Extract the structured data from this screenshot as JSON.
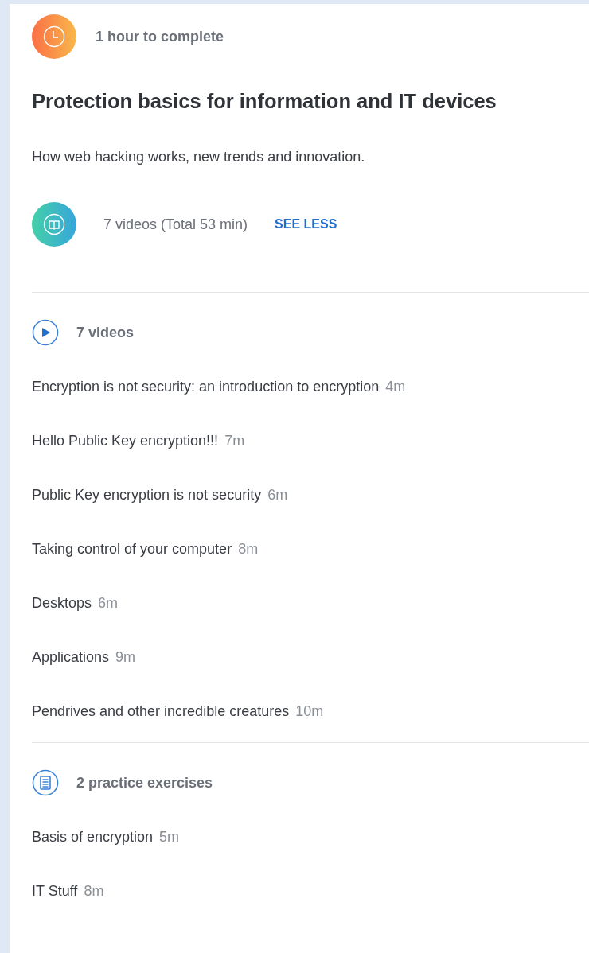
{
  "duration": {
    "label": "1 hour to complete"
  },
  "title": "Protection basics for information and IT devices",
  "description": "How web hacking works, new trends and innovation.",
  "summary": {
    "text": "7 videos (Total 53 min)",
    "toggle": "SEE LESS"
  },
  "sections": [
    {
      "kind": "videos",
      "heading": "7 videos",
      "items": [
        {
          "title": "Encryption is not security: an introduction to encryption",
          "duration": "4m"
        },
        {
          "title": "Hello Public Key encryption!!!",
          "duration": "7m"
        },
        {
          "title": "Public Key encryption is not security",
          "duration": "6m"
        },
        {
          "title": "Taking control of your computer",
          "duration": "8m"
        },
        {
          "title": "Desktops",
          "duration": "6m"
        },
        {
          "title": "Applications",
          "duration": "9m"
        },
        {
          "title": "Pendrives and other incredible creatures",
          "duration": "10m"
        }
      ]
    },
    {
      "kind": "exercises",
      "heading": "2 practice exercises",
      "items": [
        {
          "title": "Basis of encryption",
          "duration": "5m"
        },
        {
          "title": "IT Stuff",
          "duration": "8m"
        }
      ]
    }
  ]
}
